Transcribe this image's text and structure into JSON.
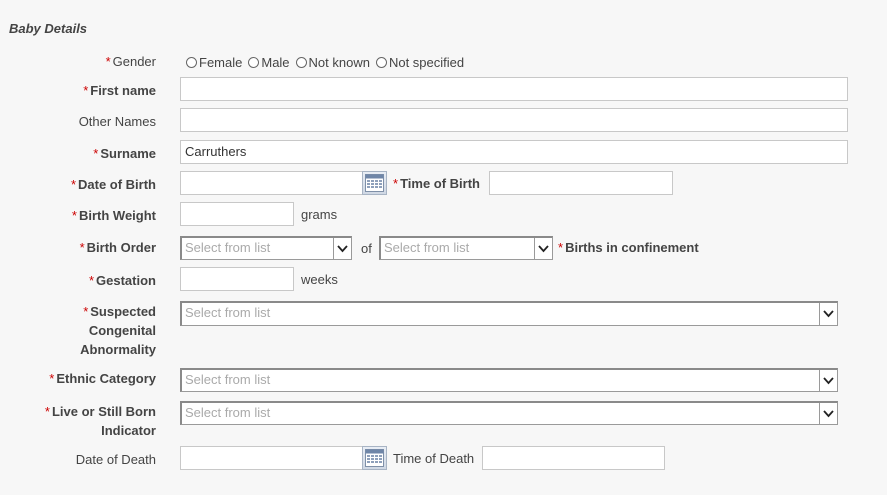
{
  "section": {
    "title": "Baby Details"
  },
  "required_marker": "*",
  "gender": {
    "label": "Gender",
    "options": [
      "Female",
      "Male",
      "Not known",
      "Not specified"
    ]
  },
  "first_name": {
    "label": "First name",
    "value": ""
  },
  "other_names": {
    "label": "Other Names",
    "value": ""
  },
  "surname": {
    "label": "Surname",
    "value": "Carruthers"
  },
  "date_of_birth": {
    "label": "Date of Birth",
    "value": ""
  },
  "time_of_birth": {
    "label": "Time of Birth",
    "value": ""
  },
  "birth_weight": {
    "label": "Birth Weight",
    "value": "",
    "unit": "grams"
  },
  "birth_order": {
    "label": "Birth Order",
    "placeholder": "Select from list",
    "of_label": "of",
    "confinement_placeholder": "Select from list",
    "confinement_label": "Births in confinement"
  },
  "gestation": {
    "label": "Gestation",
    "value": "",
    "unit": "weeks"
  },
  "congenital": {
    "label_line1": "Suspected",
    "label_line2": "Congenital",
    "label_line3": "Abnormality",
    "placeholder": "Select from list"
  },
  "ethnic": {
    "label": "Ethnic Category",
    "placeholder": "Select from list"
  },
  "live_still": {
    "label_line1": "Live or Still Born",
    "label_line2": "Indicator",
    "placeholder": "Select from list"
  },
  "date_of_death": {
    "label": "Date of Death",
    "value": ""
  },
  "time_of_death": {
    "label": "Time of Death",
    "value": ""
  },
  "icons": {
    "calendar": "calendar-icon",
    "dropdown": "chevron-down-icon"
  }
}
